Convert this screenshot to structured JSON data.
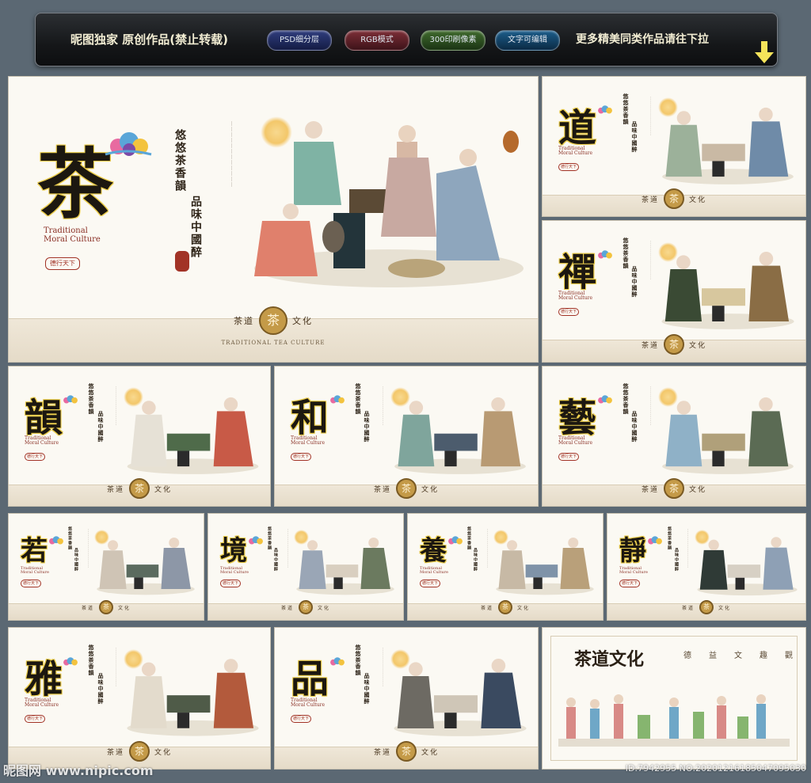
{
  "banner": {
    "title": "昵图独家 原创作品(禁止转载)",
    "pills": [
      "PSD细分层",
      "RGB模式",
      "300印刷像素",
      "文字可编辑"
    ],
    "more": "更多精美同类作品请往下拉"
  },
  "main_panel": {
    "big_char": "茶",
    "slogan_1": "悠悠茶香韻",
    "slogan_2": "品味中國醉",
    "tmc_line1": "Traditional",
    "tmc_line2": "Moral Culture",
    "seal": "德行天下",
    "emblem_char": "茶",
    "emblem_left": "茶道",
    "emblem_right": "文化",
    "footer_caption": "TRADITIONAL TEA CULTURE"
  },
  "panels": [
    {
      "char": "道"
    },
    {
      "char": "禪"
    },
    {
      "char": "韻"
    },
    {
      "char": "和"
    },
    {
      "char": "藝"
    },
    {
      "char": "若"
    },
    {
      "char": "境"
    },
    {
      "char": "養"
    },
    {
      "char": "靜"
    },
    {
      "char": "雅"
    },
    {
      "char": "品"
    }
  ],
  "scroll_panel": {
    "title": "茶道文化",
    "side_chars": [
      "德",
      "益",
      "文",
      "趣",
      "觀"
    ]
  },
  "watermark": {
    "left": "昵图网 www.nipic.com",
    "right": "ID:7942955 NO:20201216185047095030"
  },
  "colors": {
    "accent_gold": "#e8c842",
    "seal_red": "#a23326",
    "page_bg": "#5b6873"
  }
}
